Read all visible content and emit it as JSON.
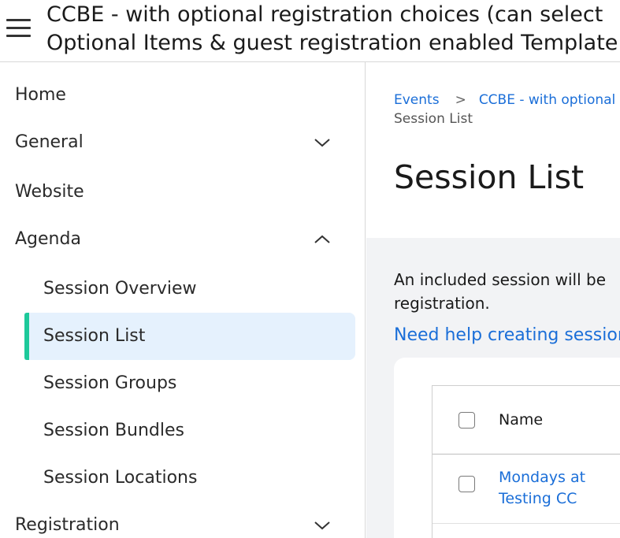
{
  "header": {
    "title_line1": "CCBE - with optional registration choices (can select",
    "title_line2": "Optional Items & guest registration enabled Template"
  },
  "sidebar": {
    "items": [
      {
        "label": "Home"
      },
      {
        "label": "General"
      },
      {
        "label": "Website"
      },
      {
        "label": "Agenda"
      },
      {
        "label": "Session Overview"
      },
      {
        "label": "Session List"
      },
      {
        "label": "Session Groups"
      },
      {
        "label": "Session Bundles"
      },
      {
        "label": "Session Locations"
      },
      {
        "label": "Registration"
      }
    ]
  },
  "breadcrumb": {
    "events": "Events",
    "separator": ">",
    "event": "CCBE - with optional re",
    "current": "Session List"
  },
  "main": {
    "page_title": "Session List",
    "intro_line1": "An included session will be",
    "intro_line2": "registration.",
    "help_link": "Need help creating sessions"
  },
  "table": {
    "columns": {
      "name": "Name"
    },
    "rows": [
      {
        "name_line1": "Mondays at",
        "name_line2": "Testing CC"
      }
    ]
  },
  "colors": {
    "accent_link": "#1a6ed8",
    "active_indicator": "#1dc99a",
    "active_background": "#e5f1fd"
  }
}
